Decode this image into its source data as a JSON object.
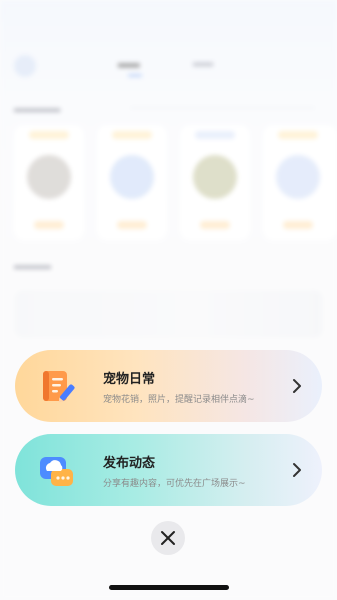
{
  "action_sheet": {
    "items": [
      {
        "id": "pet_daily",
        "title": "宠物日常",
        "subtitle": "宠物花销，照片，提醒记录相伴点滴~",
        "icon": "notebook-pencil-icon",
        "accent": "#ffd79a"
      },
      {
        "id": "post_moment",
        "title": "发布动态",
        "subtitle": "分享有趣内容，可优先在广场展示~",
        "icon": "cloud-chat-icon",
        "accent": "#7fe3da"
      }
    ],
    "close_icon": "close-icon"
  },
  "colors": {
    "pet_daily_gradient_start": "#ffd79a",
    "post_moment_gradient_start": "#7fe3da",
    "close_button_bg": "#e9e9ec"
  }
}
